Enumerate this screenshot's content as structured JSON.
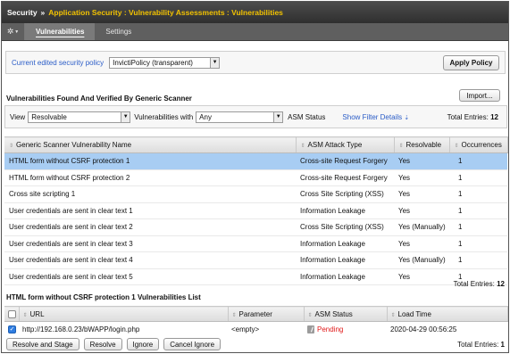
{
  "breadcrumb": {
    "root": "Security",
    "separator": "»",
    "path": "Application Security : Vulnerability Assessments : Vulnerabilities"
  },
  "tabs": [
    {
      "label": "Vulnerabilities",
      "active": true
    },
    {
      "label": "Settings",
      "active": false
    }
  ],
  "policy": {
    "label": "Current edited security policy",
    "selected": "InvictiPolicy (transparent)",
    "apply_label": "Apply Policy"
  },
  "scanner_section": {
    "title": "Vulnerabilities Found And Verified By Generic Scanner",
    "import_label": "Import..."
  },
  "filters": {
    "view_label": "View",
    "view_value": "Resolvable",
    "vuln_with_label": "Vulnerabilities with",
    "vuln_with_value": "Any",
    "asm_status_label": "ASM Status",
    "show_filter_label": "Show Filter Details",
    "total_label": "Total Entries:",
    "total_value": "12"
  },
  "vuln_table": {
    "headers": [
      "Generic Scanner Vulnerability Name",
      "ASM Attack Type",
      "Resolvable",
      "Occurrences"
    ],
    "rows": [
      [
        "HTML form without CSRF protection 1",
        "Cross-site Request Forgery",
        "Yes",
        "1"
      ],
      [
        "HTML form without CSRF protection 2",
        "Cross-site Request Forgery",
        "Yes",
        "1"
      ],
      [
        "Cross site scripting 1",
        "Cross Site Scripting (XSS)",
        "Yes",
        "1"
      ],
      [
        "User credentials are sent in clear text 1",
        "Information Leakage",
        "Yes",
        "1"
      ],
      [
        "User credentials are sent in clear text 2",
        "Cross Site Scripting (XSS)",
        "Yes (Manually)",
        "1"
      ],
      [
        "User credentials are sent in clear text 3",
        "Information Leakage",
        "Yes",
        "1"
      ],
      [
        "User credentials are sent in clear text 4",
        "Information Leakage",
        "Yes (Manually)",
        "1"
      ],
      [
        "User credentials are sent in clear text 5",
        "Information Leakage",
        "Yes",
        "1"
      ]
    ],
    "selected_row": 0,
    "total_label": "Total Entries:",
    "total_value": "12"
  },
  "list_section": {
    "title": "HTML form without CSRF protection 1 Vulnerabilities List",
    "headers": [
      "URL",
      "Parameter",
      "ASM Status",
      "Load Time"
    ],
    "rows": [
      {
        "checked": true,
        "url": "http://192.168.0.23/bWAPP/login.php",
        "parameter": "<empty>",
        "status": "Pending",
        "load_time": "2020-04-29 00:56:25"
      }
    ],
    "buttons": [
      "Resolve and Stage",
      "Resolve",
      "Ignore",
      "Cancel Ignore"
    ],
    "total_label": "Total Entries:",
    "total_value": "1"
  },
  "colors": {
    "accent_path": "#f2c200",
    "link_blue": "#2a5cc7",
    "selected_row": "#a8cdf3",
    "pending_red": "#e01818"
  },
  "icons": [
    "gear-icon",
    "dropdown-arrow-icon",
    "sort-icon",
    "checkbox-icon",
    "pending-status-icon"
  ]
}
